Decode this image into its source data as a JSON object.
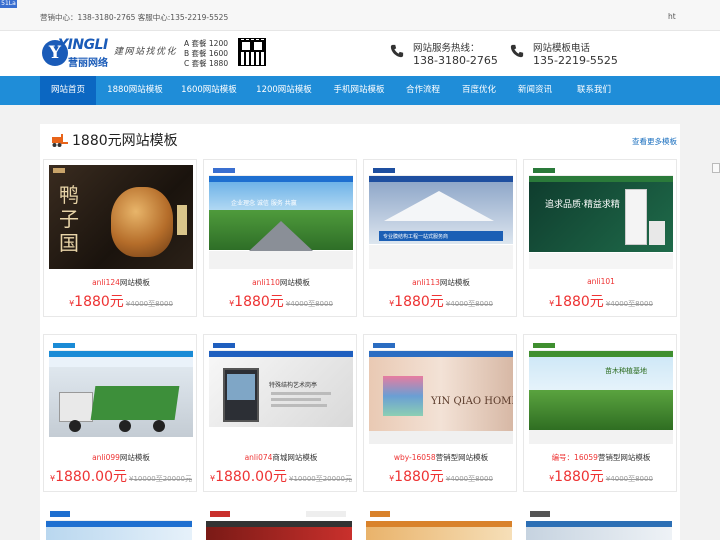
{
  "corner_badge": "51La",
  "topbar": {
    "text": "营销中心：138-3180-2765 客服中心:135-2219-5525",
    "right": "ht"
  },
  "logo": {
    "mark": "Y",
    "en": "YINGLI",
    "cn": "营丽网络"
  },
  "slogan": "建网站找优化",
  "packages": [
    "A 套餐 1200",
    "B 套餐 1600",
    "C 套餐 1880"
  ],
  "contacts": [
    {
      "label": "网站服务热线：",
      "number": "138-3180-2765",
      "icon": "phone-icon"
    },
    {
      "label": "网站模板电话",
      "number": "135-2219-5525",
      "icon": "phone-icon"
    }
  ],
  "nav": [
    "网站首页",
    "1880网站模板",
    "1600网站模板",
    "1200网站模板",
    "手机网站模板",
    "合作流程",
    "百度优化",
    "新闻资讯",
    "联系我们"
  ],
  "section": {
    "title": "1880元网站模板",
    "more": "查看更多模板"
  },
  "cards": [
    {
      "code": "anli124",
      "suffix": "网站模板",
      "price": "1880元",
      "orig": "4000至8000",
      "theme": "food"
    },
    {
      "code": "anli110",
      "suffix": "网站模板",
      "price": "1880元",
      "orig": "4000至8000",
      "theme": "road"
    },
    {
      "code": "anli113",
      "suffix": "网站模板",
      "price": "1880元",
      "orig": "4000至8000",
      "theme": "tent"
    },
    {
      "code": "anli101",
      "suffix": "",
      "price": "1880元",
      "orig": "4000至8000",
      "theme": "ac"
    },
    {
      "code": "anli099",
      "suffix": "网站模板",
      "price": "1880.00元",
      "orig": "10000至20000元",
      "theme": "truck"
    },
    {
      "code": "anli074",
      "suffix": "商城网站模板",
      "price": "1880.00元",
      "orig": "10000至20000元",
      "theme": "booth"
    },
    {
      "code": "wby-16058",
      "suffix": "营销型网站模板",
      "price": "1880元",
      "orig": "4000至8000",
      "theme": "home"
    },
    {
      "code": "编号：16059",
      "suffix": "营销型网站模板",
      "price": "1880元",
      "orig": "4000至8000",
      "theme": "farm"
    }
  ],
  "thumb_text": {
    "food": "鸭子国",
    "road": "企业理念 诚信 服务 共赢",
    "tent": "专业膜结构工程一站式服务商",
    "ac": "追求品质·精益求精",
    "truck": "",
    "booth": "特殊结构艺术岗亭",
    "home": "YIN QIAO HOME",
    "farm": "苗木种植基地"
  },
  "price_prefix": "¥"
}
